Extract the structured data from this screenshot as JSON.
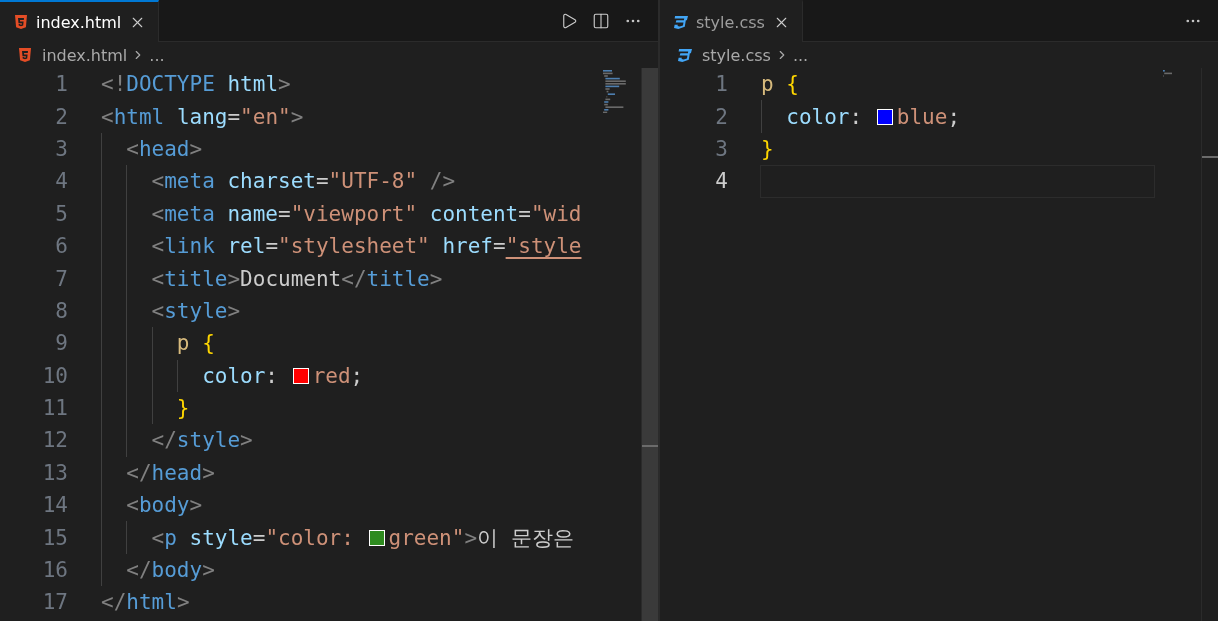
{
  "panes": [
    {
      "tab": {
        "label": "index.html",
        "kind": "html",
        "focused": true
      },
      "actions": [
        {
          "kind": "run"
        },
        {
          "kind": "split"
        },
        {
          "kind": "more"
        }
      ],
      "breadcrumb": {
        "file": "index.html",
        "more": "..."
      },
      "lines": [
        {
          "number": "1",
          "current": false,
          "tokens": [
            {
              "kind": "punct",
              "text": "<!"
            },
            {
              "kind": "tag",
              "text": "DOCTYPE"
            },
            {
              "kind": "attr",
              "text": " html"
            },
            {
              "kind": "punct",
              "text": ">"
            }
          ]
        },
        {
          "number": "2",
          "current": false,
          "tokens": [
            {
              "kind": "punct",
              "text": "<"
            },
            {
              "kind": "tag",
              "text": "html"
            },
            {
              "kind": "attr",
              "text": " lang"
            },
            {
              "kind": "plain",
              "text": "="
            },
            {
              "kind": "str",
              "text": "\"en\""
            },
            {
              "kind": "punct",
              "text": ">"
            }
          ],
          "children": [
            {
              "number": "3",
              "current": false,
              "tokens": [
                {
                  "kind": "punct",
                  "text": "<"
                },
                {
                  "kind": "tag",
                  "text": "head"
                },
                {
                  "kind": "punct",
                  "text": ">"
                }
              ],
              "children": [
                {
                  "number": "4",
                  "current": false,
                  "tokens": [
                    {
                      "kind": "punct",
                      "text": "<"
                    },
                    {
                      "kind": "tag",
                      "text": "meta"
                    },
                    {
                      "kind": "attr",
                      "text": " charset"
                    },
                    {
                      "kind": "plain",
                      "text": "="
                    },
                    {
                      "kind": "str",
                      "text": "\"UTF-8\""
                    },
                    {
                      "kind": "punct",
                      "text": " />"
                    }
                  ]
                },
                {
                  "number": "5",
                  "current": false,
                  "tokens": [
                    {
                      "kind": "punct",
                      "text": "<"
                    },
                    {
                      "kind": "tag",
                      "text": "meta"
                    },
                    {
                      "kind": "attr",
                      "text": " name"
                    },
                    {
                      "kind": "plain",
                      "text": "="
                    },
                    {
                      "kind": "str",
                      "text": "\"viewport\""
                    },
                    {
                      "kind": "attr",
                      "text": " content"
                    },
                    {
                      "kind": "plain",
                      "text": "="
                    },
                    {
                      "kind": "str",
                      "text": "\"wid"
                    }
                  ]
                },
                {
                  "number": "6",
                  "current": false,
                  "tokens": [
                    {
                      "kind": "punct",
                      "text": "<"
                    },
                    {
                      "kind": "tag",
                      "text": "link"
                    },
                    {
                      "kind": "attr",
                      "text": " rel"
                    },
                    {
                      "kind": "plain",
                      "text": "="
                    },
                    {
                      "kind": "str",
                      "text": "\"stylesheet\""
                    },
                    {
                      "kind": "attr",
                      "text": " href"
                    },
                    {
                      "kind": "plain",
                      "text": "="
                    },
                    {
                      "kind": "link",
                      "text": "\"style"
                    }
                  ]
                },
                {
                  "number": "7",
                  "current": false,
                  "tokens": [
                    {
                      "kind": "punct",
                      "text": "<"
                    },
                    {
                      "kind": "tag",
                      "text": "title"
                    },
                    {
                      "kind": "punct",
                      "text": ">"
                    },
                    {
                      "kind": "plain",
                      "text": "Document"
                    },
                    {
                      "kind": "punct",
                      "text": "</"
                    },
                    {
                      "kind": "tag",
                      "text": "title"
                    },
                    {
                      "kind": "punct",
                      "text": ">"
                    }
                  ]
                },
                {
                  "number": "8",
                  "current": false,
                  "tokens": [
                    {
                      "kind": "punct",
                      "text": "<"
                    },
                    {
                      "kind": "tag",
                      "text": "style"
                    },
                    {
                      "kind": "punct",
                      "text": ">"
                    }
                  ],
                  "children": [
                    {
                      "number": "9",
                      "current": false,
                      "tokens": [
                        {
                          "kind": "sel",
                          "text": "p"
                        },
                        {
                          "kind": "brace",
                          "text": " {"
                        }
                      ],
                      "children": [
                        {
                          "number": "10",
                          "current": false,
                          "tokens": [
                            {
                              "kind": "prop",
                              "text": "color"
                            },
                            {
                              "kind": "plain",
                              "text": ": "
                            },
                            {
                              "kind": "swatch",
                              "color": "#ff0000"
                            },
                            {
                              "kind": "val",
                              "text": "red"
                            },
                            {
                              "kind": "plain",
                              "text": ";"
                            }
                          ]
                        }
                      ]
                    },
                    {
                      "number": "11",
                      "current": false,
                      "tokens": [
                        {
                          "kind": "brace",
                          "text": "}"
                        }
                      ]
                    }
                  ]
                },
                {
                  "number": "12",
                  "current": false,
                  "tokens": [
                    {
                      "kind": "punct",
                      "text": "</"
                    },
                    {
                      "kind": "tag",
                      "text": "style"
                    },
                    {
                      "kind": "punct",
                      "text": ">"
                    }
                  ]
                }
              ]
            },
            {
              "number": "13",
              "current": false,
              "tokens": [
                {
                  "kind": "punct",
                  "text": "</"
                },
                {
                  "kind": "tag",
                  "text": "head"
                },
                {
                  "kind": "punct",
                  "text": ">"
                }
              ]
            },
            {
              "number": "14",
              "current": false,
              "tokens": [
                {
                  "kind": "punct",
                  "text": "<"
                },
                {
                  "kind": "tag",
                  "text": "body"
                },
                {
                  "kind": "punct",
                  "text": ">"
                }
              ],
              "children": [
                {
                  "number": "15",
                  "current": false,
                  "tokens": [
                    {
                      "kind": "punct",
                      "text": "<"
                    },
                    {
                      "kind": "tag",
                      "text": "p"
                    },
                    {
                      "kind": "attr",
                      "text": " style"
                    },
                    {
                      "kind": "plain",
                      "text": "="
                    },
                    {
                      "kind": "str",
                      "text": "\"color: "
                    },
                    {
                      "kind": "swatch",
                      "color": "#2e8b1f"
                    },
                    {
                      "kind": "str",
                      "text": "green\""
                    },
                    {
                      "kind": "punct",
                      "text": ">"
                    },
                    {
                      "kind": "plain",
                      "text": "이 문장은"
                    }
                  ]
                }
              ]
            },
            {
              "number": "16",
              "current": false,
              "tokens": [
                {
                  "kind": "punct",
                  "text": "</"
                },
                {
                  "kind": "tag",
                  "text": "body"
                },
                {
                  "kind": "punct",
                  "text": ">"
                }
              ]
            }
          ]
        },
        {
          "number": "17",
          "current": false,
          "tokens": [
            {
              "kind": "punct",
              "text": "</"
            },
            {
              "kind": "tag",
              "text": "html"
            },
            {
              "kind": "punct",
              "text": ">"
            }
          ]
        }
      ]
    },
    {
      "tab": {
        "label": "style.css",
        "kind": "css",
        "focused": false
      },
      "actions": [
        {
          "kind": "more"
        }
      ],
      "breadcrumb": {
        "file": "style.css",
        "more": "..."
      },
      "lines": [
        {
          "number": "1",
          "current": false,
          "tokens": [
            {
              "kind": "sel",
              "text": "p"
            },
            {
              "kind": "brace",
              "text": " {"
            }
          ],
          "children": [
            {
              "number": "2",
              "current": false,
              "tokens": [
                {
                  "kind": "prop",
                  "text": "color"
                },
                {
                  "kind": "plain",
                  "text": ": "
                },
                {
                  "kind": "swatch",
                  "color": "#0000ff"
                },
                {
                  "kind": "val",
                  "text": "blue"
                },
                {
                  "kind": "plain",
                  "text": ";"
                }
              ]
            }
          ]
        },
        {
          "number": "3",
          "current": false,
          "tokens": [
            {
              "kind": "brace",
              "text": "}"
            }
          ]
        },
        {
          "number": "4",
          "current": true
        }
      ]
    }
  ]
}
